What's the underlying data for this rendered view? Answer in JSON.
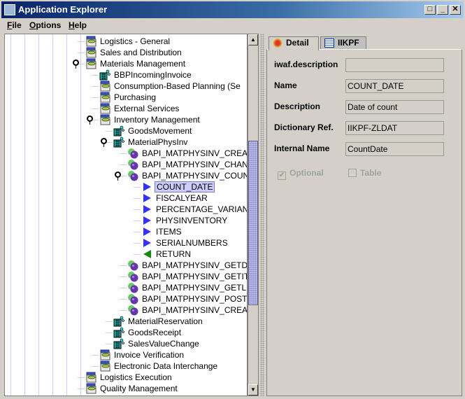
{
  "window": {
    "title": "Application Explorer",
    "minimize": "_",
    "maximize": "□",
    "close": "✕"
  },
  "menu": [
    {
      "label": "File",
      "mnemonic": "F",
      "rest": "ile"
    },
    {
      "label": "Options",
      "mnemonic": "O",
      "rest": "ptions"
    },
    {
      "label": "Help",
      "mnemonic": "H",
      "rest": "elp"
    }
  ],
  "tree": [
    {
      "label": "Logistics - General",
      "level": 0,
      "icon": "folder-icon"
    },
    {
      "label": "Sales and Distribution",
      "level": 0,
      "icon": "folder-icon"
    },
    {
      "label": "Materials Management",
      "level": 0,
      "icon": "folder-icon",
      "expanded": true
    },
    {
      "label": "BBPIncomingInvoice",
      "level": 1,
      "icon": "business-object-icon"
    },
    {
      "label": "Consumption-Based Planning (Se",
      "level": 1,
      "icon": "folder-icon"
    },
    {
      "label": "Purchasing",
      "level": 1,
      "icon": "folder-icon"
    },
    {
      "label": "External Services",
      "level": 1,
      "icon": "folder-icon"
    },
    {
      "label": "Inventory Management",
      "level": 1,
      "icon": "folder-icon",
      "expanded": true
    },
    {
      "label": "GoodsMovement",
      "level": 2,
      "icon": "business-object-icon"
    },
    {
      "label": "MaterialPhysInv",
      "level": 2,
      "icon": "business-object-icon",
      "expanded": true
    },
    {
      "label": "BAPI_MATPHYSINV_CREA",
      "level": 3,
      "icon": "method-icon"
    },
    {
      "label": "BAPI_MATPHYSINV_CHAN",
      "level": 3,
      "icon": "method-icon"
    },
    {
      "label": "BAPI_MATPHYSINV_COUN",
      "level": 3,
      "icon": "method-icon",
      "expanded": true
    },
    {
      "label": "COUNT_DATE",
      "level": 4,
      "icon": "import-param-icon",
      "selected": true
    },
    {
      "label": "FISCALYEAR",
      "level": 4,
      "icon": "import-param-icon"
    },
    {
      "label": "PERCENTAGE_VARIAN",
      "level": 4,
      "icon": "import-param-icon"
    },
    {
      "label": "PHYSINVENTORY",
      "level": 4,
      "icon": "import-param-icon"
    },
    {
      "label": "ITEMS",
      "level": 4,
      "icon": "import-param-icon"
    },
    {
      "label": "SERIALNUMBERS",
      "level": 4,
      "icon": "import-param-icon"
    },
    {
      "label": "RETURN",
      "level": 4,
      "icon": "export-param-icon"
    },
    {
      "label": "BAPI_MATPHYSINV_GETD",
      "level": 3,
      "icon": "method-icon"
    },
    {
      "label": "BAPI_MATPHYSINV_GETIT",
      "level": 3,
      "icon": "method-icon"
    },
    {
      "label": "BAPI_MATPHYSINV_GETL",
      "level": 3,
      "icon": "method-icon"
    },
    {
      "label": "BAPI_MATPHYSINV_POST",
      "level": 3,
      "icon": "method-icon"
    },
    {
      "label": "BAPI_MATPHYSINV_CREA",
      "level": 3,
      "icon": "method-icon"
    },
    {
      "label": "MaterialReservation",
      "level": 2,
      "icon": "business-object-icon"
    },
    {
      "label": "GoodsReceipt",
      "level": 2,
      "icon": "business-object-icon"
    },
    {
      "label": "SalesValueChange",
      "level": 2,
      "icon": "business-object-icon"
    },
    {
      "label": "Invoice Verification",
      "level": 1,
      "icon": "folder-icon"
    },
    {
      "label": "Electronic Data Interchange",
      "level": 1,
      "icon": "folder-icon"
    },
    {
      "label": "Logistics Execution",
      "level": 0,
      "icon": "folder-icon"
    },
    {
      "label": "Quality Management",
      "level": 0,
      "icon": "folder-icon"
    }
  ],
  "scrollbar": {
    "position_percent": 37
  },
  "tabs": [
    {
      "label": "Detail",
      "icon": "detail-icon",
      "active": true
    },
    {
      "label": "IIKPF",
      "icon": "table-icon",
      "active": false
    }
  ],
  "detail": {
    "fields": [
      {
        "label": "iwaf.description",
        "value": ""
      },
      {
        "label": "Name",
        "value": "COUNT_DATE"
      },
      {
        "label": "Description",
        "value": "Date of count"
      },
      {
        "label": "Dictionary Ref.",
        "value": "IIKPF-ZLDAT"
      },
      {
        "label": "Internal Name",
        "value": "CountDate"
      }
    ],
    "optional": {
      "label": "Optional",
      "checked": true
    },
    "table": {
      "label": "Table",
      "checked": false
    }
  },
  "colors": {
    "selection": "#ccccff",
    "titlebar": "#0a246a",
    "scroll_thumb": "#9999cc"
  }
}
